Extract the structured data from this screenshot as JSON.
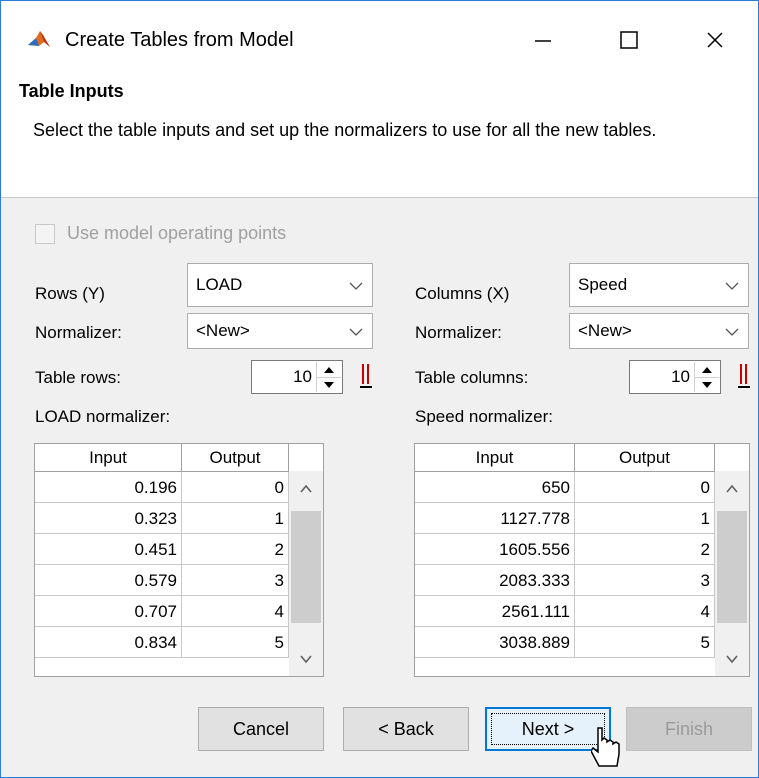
{
  "window": {
    "title": "Create Tables from Model",
    "controls": {
      "minimize": "—",
      "maximize": "☐",
      "close": "✕"
    }
  },
  "header": {
    "title": "Table Inputs",
    "description": "Select the table inputs and set up the normalizers to use for all the new tables."
  },
  "use_op_points": {
    "label": "Use model operating points",
    "checked": false,
    "enabled": false
  },
  "left": {
    "rows_label": "Rows (Y)",
    "rows_value": "LOAD",
    "normalizer_label": "Normalizer:",
    "normalizer_value": "<New>",
    "count_label": "Table rows:",
    "count_value": "10",
    "norm_table_label": "LOAD normalizer:",
    "columns": [
      "Input",
      "Output"
    ],
    "rows": [
      [
        "0.196",
        "0"
      ],
      [
        "0.323",
        "1"
      ],
      [
        "0.451",
        "2"
      ],
      [
        "0.579",
        "3"
      ],
      [
        "0.707",
        "4"
      ],
      [
        "0.834",
        "5"
      ]
    ]
  },
  "right": {
    "cols_label": "Columns (X)",
    "cols_value": "Speed",
    "normalizer_label": "Normalizer:",
    "normalizer_value": "<New>",
    "count_label": "Table columns:",
    "count_value": "10",
    "norm_table_label": "Speed normalizer:",
    "columns": [
      "Input",
      "Output"
    ],
    "rows": [
      [
        "650",
        "0"
      ],
      [
        "1127.778",
        "1"
      ],
      [
        "1605.556",
        "2"
      ],
      [
        "2083.333",
        "3"
      ],
      [
        "2561.111",
        "4"
      ],
      [
        "3038.889",
        "5"
      ]
    ]
  },
  "buttons": {
    "cancel": "Cancel",
    "back": "< Back",
    "next": "Next >",
    "finish": "Finish"
  },
  "colors": {
    "accent": "#0078d7",
    "window_border": "#2b7bd8",
    "marker_red": "#cc0000"
  }
}
